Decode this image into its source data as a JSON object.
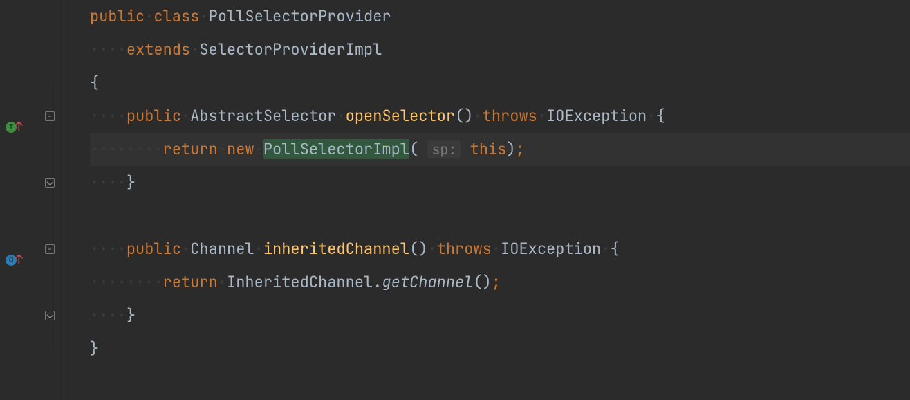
{
  "colors": {
    "bg": "#2b2b2b",
    "keyword": "#cc7832",
    "method": "#ffc66d",
    "text": "#a9b7c6",
    "hint": "#787878"
  },
  "gutter": {
    "implements_icon": "I",
    "overrides_icon": "O",
    "up_arrow": "↑",
    "fold_minus": "−"
  },
  "code": {
    "kw_public": "public",
    "kw_class": "class",
    "class_name": "PollSelectorProvider",
    "kw_extends": "extends",
    "super_class": "SelectorProviderImpl",
    "brace_open": "{",
    "brace_close": "}",
    "m1_ret": "AbstractSelector",
    "m1_name": "openSelector",
    "kw_throws": "throws",
    "exc": "IOException",
    "kw_return": "return",
    "kw_new": "new",
    "ctor": "PollSelectorImpl",
    "hint_sp": "sp:",
    "kw_this": "this",
    "paren_open": "(",
    "paren_close": ")",
    "semi": ";",
    "empty_parens": "()",
    "m2_ret": "Channel",
    "m2_name": "inheritedChannel",
    "m2_callee_cls": "InheritedChannel",
    "m2_callee_mtd": "getChannel",
    "dot": "."
  }
}
